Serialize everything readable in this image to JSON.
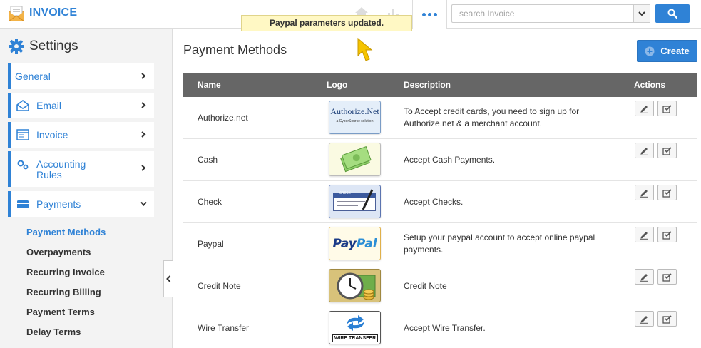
{
  "app": {
    "title": "INVOICE"
  },
  "header": {
    "search_placeholder": "search Invoice",
    "icons": [
      "envelope-icon",
      "home-icon",
      "chart-icon",
      "more-dots-icon",
      "chevron-down-icon",
      "search-icon"
    ]
  },
  "toast": {
    "message": "Paypal parameters updated."
  },
  "sidebar": {
    "title": "Settings",
    "items": [
      {
        "label": "General",
        "icon": ""
      },
      {
        "label": "Email",
        "icon": "envelope-open-icon"
      },
      {
        "label": "Invoice",
        "icon": "invoice-icon"
      },
      {
        "label": "Accounting Rules",
        "label_line1": "Accounting",
        "label_line2": "Rules",
        "icon": "gears-icon"
      },
      {
        "label": "Payments",
        "icon": "card-icon"
      }
    ],
    "sub_items": [
      {
        "label": "Payment Methods",
        "active": true
      },
      {
        "label": "Overpayments"
      },
      {
        "label": "Recurring Invoice"
      },
      {
        "label": "Recurring Billing"
      },
      {
        "label": "Payment Terms"
      },
      {
        "label": "Delay Terms"
      }
    ]
  },
  "main": {
    "title": "Payment Methods",
    "create_label": "Create",
    "columns": [
      "Name",
      "Logo",
      "Description",
      "Actions"
    ],
    "rows": [
      {
        "name": "Authorize.net",
        "logo": "authorize-net-logo",
        "logo_text": "Authorize.Net",
        "logo_subtext": "a CyberSource solution",
        "description": "To Accept credit cards, you need to sign up for Authorize.net & a merchant account."
      },
      {
        "name": "Cash",
        "logo": "cash-logo",
        "description": "Accept Cash Payments."
      },
      {
        "name": "Check",
        "logo": "check-logo",
        "logo_text": "check",
        "description": "Accept Checks."
      },
      {
        "name": "Paypal",
        "logo": "paypal-logo",
        "logo_text_pay": "Pay",
        "logo_text_pal": "Pal",
        "description": "Setup your paypal account to accept online paypal payments."
      },
      {
        "name": "Credit Note",
        "logo": "credit-note-logo",
        "description": "Credit Note"
      },
      {
        "name": "Wire Transfer",
        "logo": "wire-transfer-logo",
        "logo_text": "WIRE TRANSFER",
        "description": "Accept Wire Transfer."
      }
    ]
  },
  "colors": {
    "accent": "#2f82d6",
    "table_header": "#666666",
    "toast_bg": "#fff8c4"
  }
}
